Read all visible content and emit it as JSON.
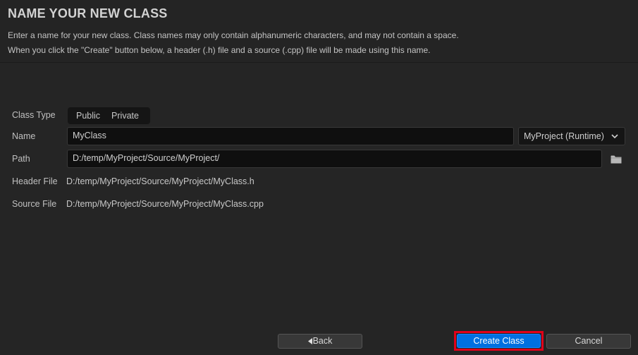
{
  "dialog": {
    "title": "NAME YOUR NEW CLASS",
    "description_line1": "Enter a name for your new class. Class names may only contain alphanumeric characters, and may not contain a space.",
    "description_line2": "When you click the \"Create\" button below, a header (.h) file and a source (.cpp) file will be made using this name."
  },
  "form": {
    "class_type_label": "Class Type",
    "class_type_options": [
      "Public",
      "Private"
    ],
    "name_label": "Name",
    "name_value": "MyClass",
    "module_value": "MyProject (Runtime)",
    "path_label": "Path",
    "path_value": "D:/temp/MyProject/Source/MyProject/",
    "header_file_label": "Header File",
    "header_file_value": "D:/temp/MyProject/Source/MyProject/MyClass.h",
    "source_file_label": "Source File",
    "source_file_value": "D:/temp/MyProject/Source/MyProject/MyClass.cpp"
  },
  "buttons": {
    "back_label": "Back",
    "create_label": "Create Class",
    "cancel_label": "Cancel"
  },
  "icons": {
    "back_arrow": "chevron-left-icon",
    "dropdown": "chevron-down-icon",
    "browse": "folder-icon"
  },
  "colors": {
    "background": "#252525",
    "primary_button": "#0070e0",
    "highlight_border": "#e0001a"
  }
}
